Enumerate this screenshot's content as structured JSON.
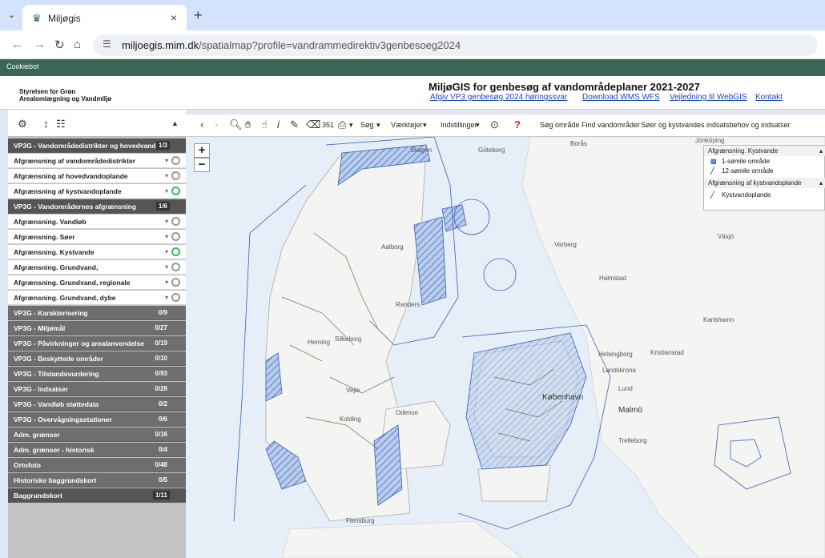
{
  "browser": {
    "tab_title": "Miljøgis",
    "tab_close": "×",
    "new_tab": "+",
    "dropdown": "⌄",
    "url_host": "miljoegis.mim.dk",
    "url_path": "/spatialmap?profile=vandrammedirektiv3genbesoeg2024"
  },
  "cookie_bar": "Cookiebot",
  "header": {
    "org_line1": "Styrelsen for Grøn",
    "org_line2": "Arealomlægning og Vandmiljø",
    "title": "MiljøGIS for genbesøg af vandområdeplaner 2021-2027",
    "links": [
      "Afgiv VP3 genbesøg 2024 høringssvar",
      "Download WMS WFS",
      "Vejledning til WebGIS",
      "Kontakt"
    ]
  },
  "toolbar": {
    "search": "Søg",
    "tools": "Værktøjer",
    "settings": "Indstillinger",
    "search_area": "Søg område",
    "find_areas": "Find vandområder",
    "lakes_coast": "Søer og kystvandes indsatsbehov og indsatser",
    "measure": "351"
  },
  "layers": [
    {
      "type": "group",
      "label": "VP3G - Vandområdedistrikter og hovedvandopl",
      "count": "1/3",
      "open": true
    },
    {
      "type": "layer",
      "label": "Afgrænsning af vandområdedistrikter",
      "on": false
    },
    {
      "type": "layer",
      "label": "Afgrænsning af hovedvandoplande",
      "on": false
    },
    {
      "type": "layer",
      "label": "Afgrænsning af kystvandoplande",
      "on": true
    },
    {
      "type": "group",
      "label": "VP3G - Vandområdernes afgrænsning",
      "count": "1/6",
      "open": true
    },
    {
      "type": "layer",
      "label": "Afgrænsning. Vandløb",
      "on": false
    },
    {
      "type": "layer",
      "label": "Afgrænsning. Søer",
      "on": false
    },
    {
      "type": "layer",
      "label": "Afgrænsning. Kystvande",
      "on": true
    },
    {
      "type": "layer",
      "label": "Afgrænsning. Grundvand,",
      "on": false
    },
    {
      "type": "layer",
      "label": "Afgrænsning. Grundvand, regionale",
      "on": false
    },
    {
      "type": "layer",
      "label": "Afgrænsning. Grundvand, dybe",
      "on": false
    },
    {
      "type": "group",
      "label": "VP3G - Karakterisering",
      "count": "0/9",
      "open": false
    },
    {
      "type": "group",
      "label": "VP3G - Miljømål",
      "count": "0/27",
      "open": false
    },
    {
      "type": "group",
      "label": "VP3G - Påvirkninger og arealanvendelse",
      "count": "0/19",
      "open": false
    },
    {
      "type": "group",
      "label": "VP3G - Beskyttede områder",
      "count": "0/10",
      "open": false
    },
    {
      "type": "group",
      "label": "VP3G - Tilstandsvurdering",
      "count": "0/93",
      "open": false
    },
    {
      "type": "group",
      "label": "VP3G - Indsatser",
      "count": "0/28",
      "open": false
    },
    {
      "type": "group",
      "label": "VP3G - Vandløb støttedata",
      "count": "0/2",
      "open": false
    },
    {
      "type": "group",
      "label": "VP3G - Overvågningsstationer",
      "count": "0/6",
      "open": false
    },
    {
      "type": "group",
      "label": "Adm. grænser",
      "count": "0/16",
      "open": false
    },
    {
      "type": "group",
      "label": "Adm. grænser - historisk",
      "count": "0/4",
      "open": false
    },
    {
      "type": "group",
      "label": "Ortofoto",
      "count": "0/48",
      "open": false
    },
    {
      "type": "group",
      "label": "Historiske baggrundskort",
      "count": "0/5",
      "open": false
    },
    {
      "type": "group",
      "label": "Baggrundskort",
      "count": "1/11",
      "open": true
    }
  ],
  "legend": {
    "section1": "Afgrænsning. Kystvande",
    "item1": "1-sømile område",
    "item2": "12-sømile område",
    "section2": "Afgrænsning af kystvandoplande",
    "item3": "Kystvandoplande"
  },
  "map_places": {
    "goteborg": "Göteborg",
    "boras": "Borås",
    "varberg": "Varberg",
    "halmstad": "Halmstad",
    "aalborg": "Aalborg",
    "herning": "Herning",
    "silkeborg": "Silkeborg",
    "vejle": "Vejle",
    "kolding": "Kolding",
    "odense": "Odense",
    "kobenhavn": "København",
    "malmo": "Malmö",
    "lund": "Lund",
    "landskrona": "Landskrona",
    "helsingborg": "Helsingborg",
    "kristianstad": "Kristianstad",
    "karlshamn": "Karlshamn",
    "trelleborg": "Trelleborg",
    "flensburg": "Flensburg",
    "vaxjo": "Växjö",
    "skagen": "Skagen",
    "randers": "Randers",
    "jonkoping": "Jönköping"
  }
}
